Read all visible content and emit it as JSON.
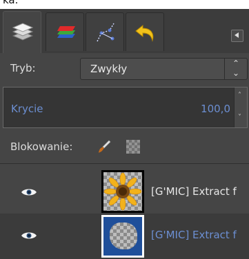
{
  "top_label": "ka.",
  "tabs": [
    {
      "name": "layers",
      "active": true
    },
    {
      "name": "channels",
      "active": false
    },
    {
      "name": "paths",
      "active": false
    },
    {
      "name": "undo-history",
      "active": false
    }
  ],
  "mode": {
    "label": "Tryb:",
    "value": "Zwykły"
  },
  "opacity": {
    "label": "Krycie",
    "value": "100,0"
  },
  "lock": {
    "label": "Blokowanie:",
    "icons": [
      "brush-icon",
      "checker-icon"
    ]
  },
  "layers": [
    {
      "name": "[G'MIC] Extract f",
      "selected": false,
      "visible": true
    },
    {
      "name": "[G'MIC] Extract f",
      "selected": true,
      "visible": true
    }
  ],
  "colors": {
    "accent": "#6c8fd2",
    "panel": "#454545",
    "tabbar": "#3c3c3c"
  }
}
